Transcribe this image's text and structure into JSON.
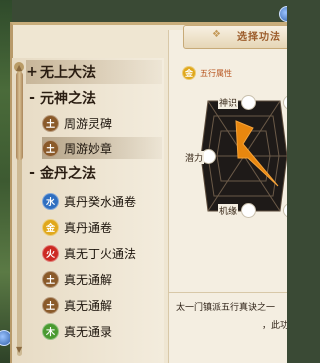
{
  "header": {
    "title": "选择功法"
  },
  "categories": [
    {
      "sign": "+",
      "label": "无上大法"
    },
    {
      "sign": "-",
      "label": "元神之法"
    },
    {
      "sign": "-",
      "label": "金丹之法"
    }
  ],
  "skills_yuanshen": [
    {
      "element": "土",
      "label": "周游灵碑"
    },
    {
      "element": "土",
      "label": "周游妙章"
    }
  ],
  "skills_jindan": [
    {
      "element": "水",
      "label": "真丹癸水通卷"
    },
    {
      "element": "金",
      "label": "真丹通卷"
    },
    {
      "element": "火",
      "label": "真无丁火通法"
    },
    {
      "element": "土",
      "label": "真无通解"
    },
    {
      "element": "土",
      "label": "真无通解"
    },
    {
      "element": "木",
      "label": "真无通录"
    }
  ],
  "attribute": {
    "element": "金",
    "text": "五行属性"
  },
  "stats": {
    "shenshi": "神识",
    "qianli": "潜力",
    "jiyuan": "机缘"
  },
  "description": {
    "line1": "太一门镇派五行真诀之一",
    "line2": "，此功"
  },
  "colors": {
    "earth": "#8a5a2a",
    "water": "#2f6fc0",
    "metal": "#e0a81c",
    "fire": "#cc2a22",
    "wood": "#4a9a30",
    "radar": "#e8870f"
  }
}
